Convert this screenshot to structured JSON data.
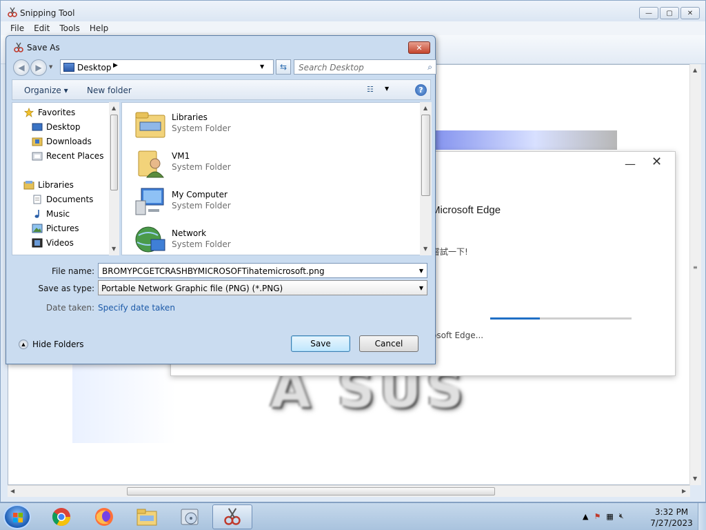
{
  "snipping_tool": {
    "title": "Snipping Tool",
    "menu": [
      "File",
      "Edit",
      "Tools",
      "Help"
    ],
    "controls": {
      "minimize": "—",
      "restore": "▢",
      "close": "✕"
    }
  },
  "captured": {
    "edge_title": "Microsoft Edge",
    "edge_cjk": "嘗試一下!",
    "edge_status": "osoft Edge...",
    "edge_progress": 0.35,
    "asus_text": "A SUS"
  },
  "save_as": {
    "title": "Save As",
    "close_glyph": "✕",
    "address": "Desktop",
    "search_placeholder": "Search Desktop",
    "cmd": {
      "organize": "Organize",
      "new_folder": "New folder"
    },
    "nav": {
      "favorites": "Favorites",
      "desktop": "Desktop",
      "downloads": "Downloads",
      "recent_places": "Recent Places",
      "libraries": "Libraries",
      "documents": "Documents",
      "music": "Music",
      "pictures": "Pictures",
      "videos": "Videos"
    },
    "files": [
      {
        "name": "Libraries",
        "type": "System Folder"
      },
      {
        "name": "VM1",
        "type": "System Folder"
      },
      {
        "name": "My Computer",
        "type": "System Folder"
      },
      {
        "name": "Network",
        "type": "System Folder"
      }
    ],
    "labels": {
      "file_name": "File name:",
      "save_as_type": "Save as type:",
      "date_taken": "Date taken:"
    },
    "file_name_value": "BROMYPCGETCRASHBYMICROSOFTihatemicrosoft.png",
    "save_as_type_value": "Portable Network Graphic file (PNG) (*.PNG)",
    "date_taken_link": "Specify date taken",
    "hide_folders": "Hide Folders",
    "save_button": "Save",
    "cancel_button": "Cancel"
  },
  "taskbar": {
    "time": "3:32 PM",
    "date": "7/27/2023"
  }
}
